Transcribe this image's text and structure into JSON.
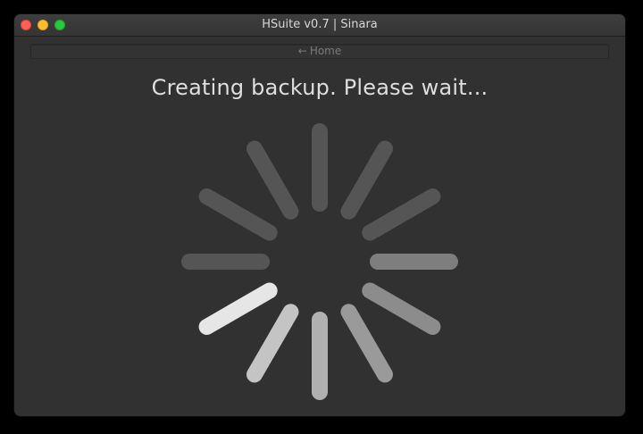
{
  "window": {
    "title": "HSuite v0.7 | Sinara"
  },
  "nav": {
    "home_icon": "arrow-left-icon",
    "home_label": "Home"
  },
  "main": {
    "status_message": "Creating backup. Please wait..."
  },
  "spinner": {
    "type": "activity-indicator",
    "spoke_count": 12,
    "active_spoke": 8,
    "colors": {
      "active": "#e6e6e6",
      "trail_1": "#c4c4c4",
      "trail_2": "#b0b0b0",
      "trail_3": "#9a9a9a",
      "trail_4": "#8c8c8c",
      "trail_5": "#7e7e7e",
      "idle": "#555555"
    }
  },
  "colors": {
    "window_bg": "#313131",
    "close": "#fe5f57",
    "minimize": "#febc2e",
    "maximize": "#28c840"
  }
}
